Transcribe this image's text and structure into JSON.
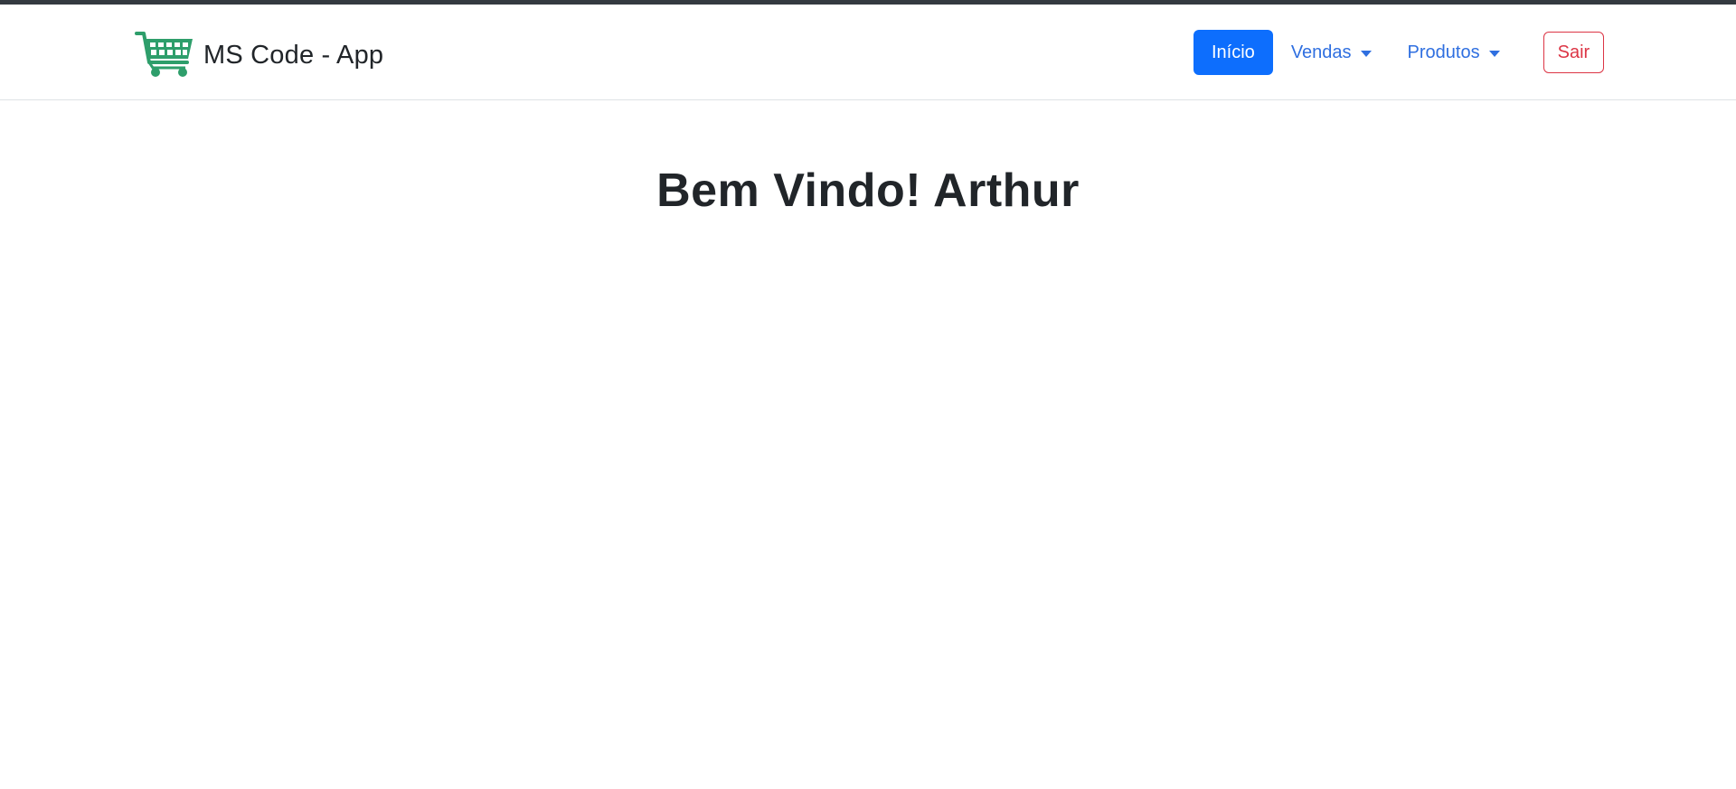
{
  "brand": {
    "name": "MS Code - App",
    "icon": "shopping-cart-icon",
    "icon_color": "#2e9e6b"
  },
  "nav": {
    "home_label": "Início",
    "sales_label": "Vendas",
    "products_label": "Produtos",
    "logout_label": "Sair"
  },
  "main": {
    "welcome_text": "Bem Vindo! Arthur"
  },
  "colors": {
    "primary": "#0d6efd",
    "danger": "#dc3545",
    "link": "#2f6fe0",
    "topbar": "#343a40"
  }
}
